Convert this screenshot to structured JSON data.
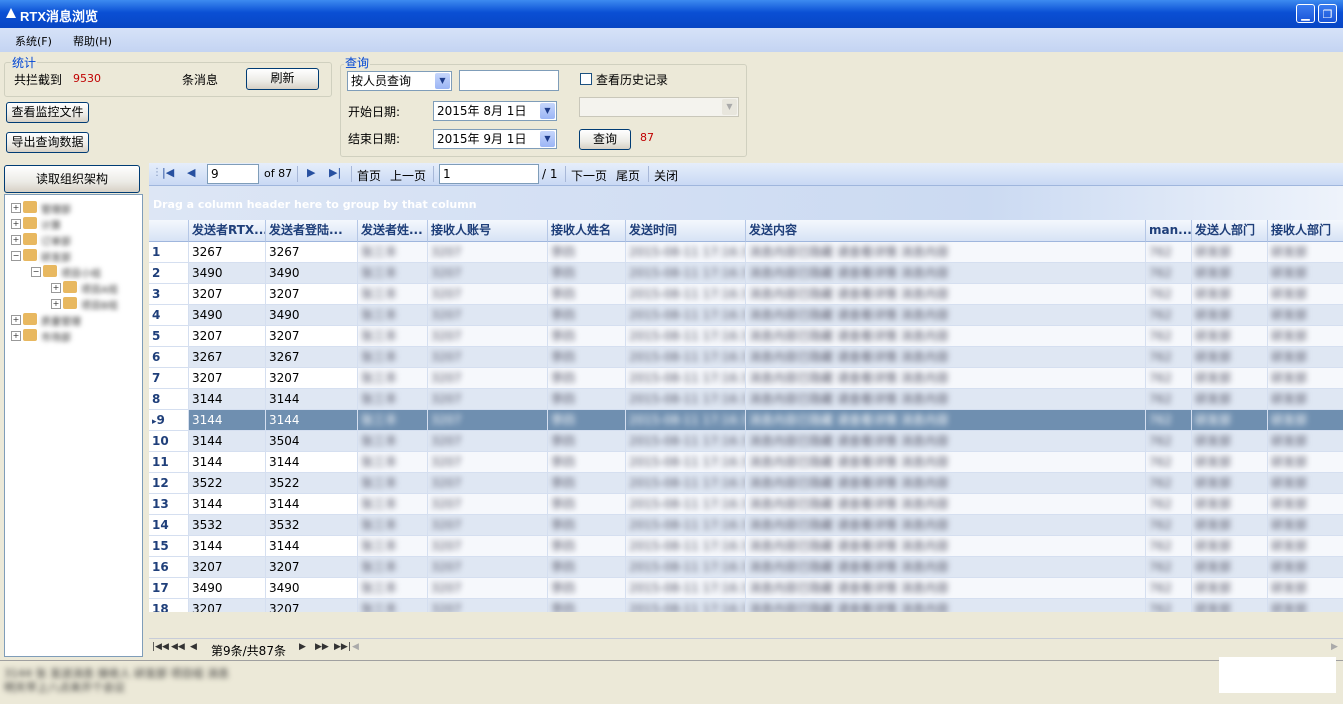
{
  "window": {
    "title": "RTX消息浏览"
  },
  "menu": [
    "系统(F)",
    "帮助(H)"
  ],
  "stats": {
    "group_title": "统计",
    "label": "共拦截到",
    "count": "9530",
    "unit": "条消息",
    "refresh": "刷新"
  },
  "actions": {
    "view_monitor": "查看监控文件",
    "export": "导出查询数据",
    "read_org": "读取组织架构"
  },
  "query": {
    "group_title": "查询",
    "mode": "按人员查询",
    "keyword": "",
    "history_label": "查看历史记录",
    "start_label": "开始日期:",
    "start_date": "2015年 8月 1日",
    "end_label": "结束日期:",
    "end_date": "2015年 9月 1日",
    "submit": "查询",
    "result_count": "87"
  },
  "toolbar": {
    "page_value": "9",
    "of_label": "of 87",
    "first": "首页",
    "prev": "上一页",
    "page_input": "1",
    "page_total": "/ 1",
    "next": "下一页",
    "last": "尾页",
    "close": "关闭"
  },
  "grid": {
    "group_hint": "Drag a column header here to group by that column",
    "columns": [
      "发送者RTX...",
      "发送者登陆...",
      "发送者姓...",
      "接收人账号",
      "接收人姓名",
      "发送时间",
      "发送内容",
      "man...",
      "发送人部门",
      "接收人部门"
    ],
    "rows": [
      {
        "n": "1",
        "rtx": "3267",
        "login": "3267"
      },
      {
        "n": "2",
        "rtx": "3490",
        "login": "3490"
      },
      {
        "n": "3",
        "rtx": "3207",
        "login": "3207"
      },
      {
        "n": "4",
        "rtx": "3490",
        "login": "3490"
      },
      {
        "n": "5",
        "rtx": "3207",
        "login": "3207"
      },
      {
        "n": "6",
        "rtx": "3267",
        "login": "3267"
      },
      {
        "n": "7",
        "rtx": "3207",
        "login": "3207"
      },
      {
        "n": "8",
        "rtx": "3144",
        "login": "3144"
      },
      {
        "n": "9",
        "rtx": "3144",
        "login": "3144"
      },
      {
        "n": "10",
        "rtx": "3144",
        "login": "3504"
      },
      {
        "n": "11",
        "rtx": "3144",
        "login": "3144"
      },
      {
        "n": "12",
        "rtx": "3522",
        "login": "3522"
      },
      {
        "n": "13",
        "rtx": "3144",
        "login": "3144"
      },
      {
        "n": "14",
        "rtx": "3532",
        "login": "3532"
      },
      {
        "n": "15",
        "rtx": "3144",
        "login": "3144"
      },
      {
        "n": "16",
        "rtx": "3207",
        "login": "3207"
      },
      {
        "n": "17",
        "rtx": "3490",
        "login": "3490"
      },
      {
        "n": "18",
        "rtx": "3207",
        "login": "3207"
      }
    ],
    "selected_row": "9",
    "footer": "第9条/共87条"
  },
  "colors": {
    "accent": "#0046d5",
    "count": "#c00000",
    "selected": "#6f8fb0"
  }
}
